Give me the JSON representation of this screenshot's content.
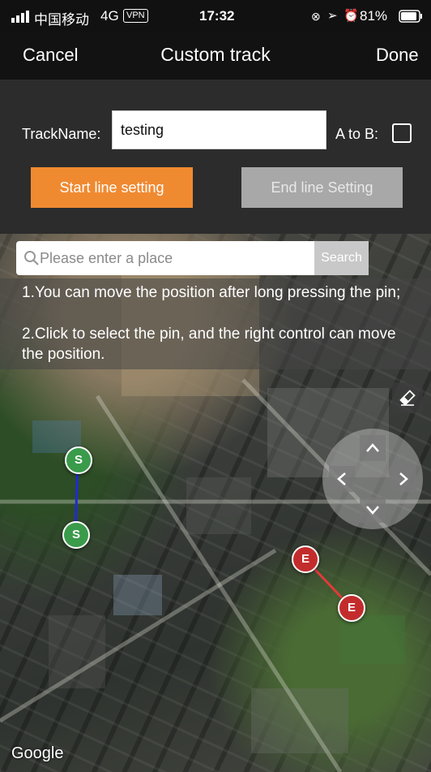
{
  "status_bar": {
    "carrier": "中国移动",
    "network": "4G",
    "vpn": "VPN",
    "time": "17:32",
    "battery": "81%"
  },
  "nav": {
    "cancel": "Cancel",
    "title": "Custom track",
    "done": "Done"
  },
  "form": {
    "track_name_label": "TrackName:",
    "track_name_value": "testing",
    "a_to_b_label": "A to B:",
    "a_to_b_checked": false,
    "start_button": "Start line setting",
    "end_button": "End line Setting",
    "start_color": "#f08a31",
    "end_color": "#a8a8a8"
  },
  "search": {
    "placeholder": "Please enter a place",
    "button": "Search"
  },
  "instructions": {
    "line1": "1.You can move the position after long pressing the pin;",
    "line2": "2.Click to select the pin, and the right control can move the position."
  },
  "pins": {
    "start_label": "S",
    "end_label": "E",
    "start_line_color": "#1f2bd6",
    "end_line_color": "#e03a3a"
  },
  "map": {
    "attribution": "Google"
  }
}
